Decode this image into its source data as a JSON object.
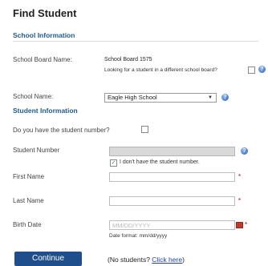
{
  "page_title": "Find Student",
  "school_info": {
    "heading": "School Information",
    "board_label": "School Board Name:",
    "board_value": "School Board 1575",
    "different_board_text": "Looking for a student in a different school board?",
    "school_label": "School Name:",
    "school_value": "Eagle High School"
  },
  "student_info": {
    "heading": "Student Information",
    "have_number_text": "Do you have the student number?",
    "student_number_label": "Student Number",
    "dont_have_text": "I don't have the student number.",
    "first_name_label": "First Name",
    "last_name_label": "Last Name",
    "birth_date_label": "Birth Date",
    "birth_date_placeholder": "MM/DD/YYYY",
    "date_format_text": "Date format: mm/dd/yyyy",
    "required_marker": "*"
  },
  "actions": {
    "continue_label": "Continue",
    "no_students_prefix": "(No students? ",
    "click_here": "Click here",
    "no_students_suffix": ")"
  }
}
